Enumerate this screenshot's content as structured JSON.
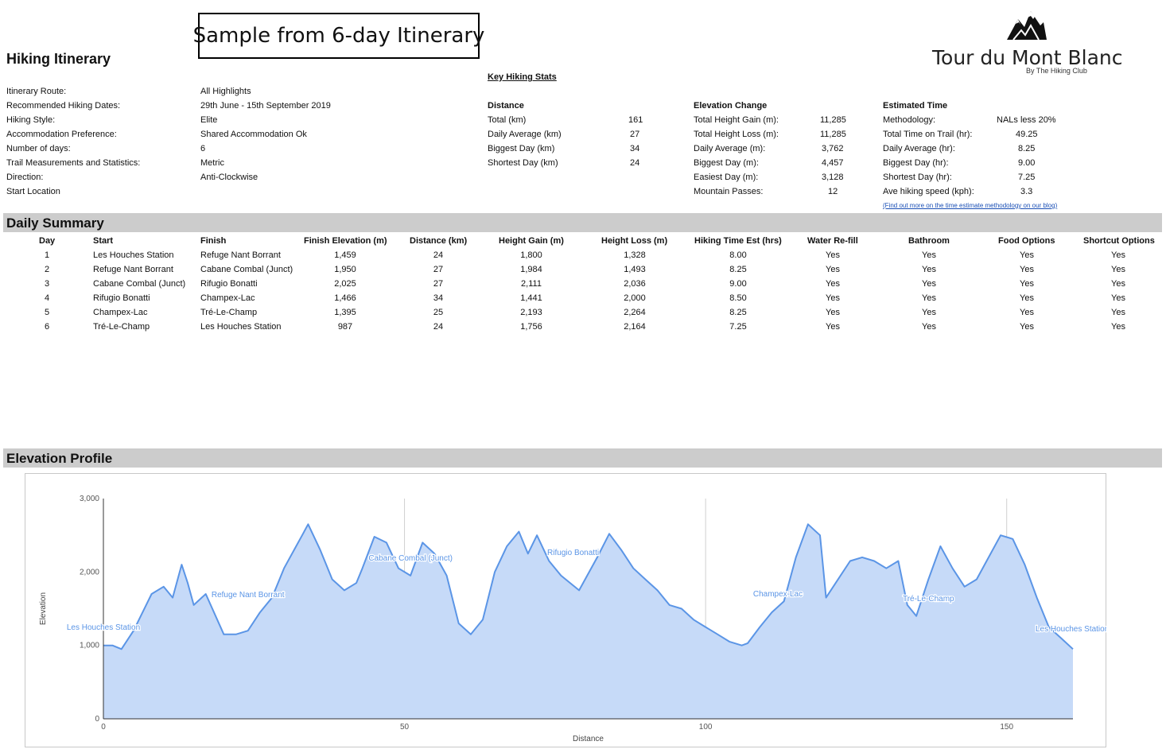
{
  "header": {
    "title": "Hiking Itinerary",
    "sample_label": "Sample from 6-day Itinerary",
    "logo_name": "Tour du Mont Blanc",
    "logo_sub": "By The Hiking Club"
  },
  "itinerary": [
    {
      "label": "Itinerary Route:",
      "value": "All Highlights"
    },
    {
      "label": "Recommended Hiking Dates:",
      "value": "29th June - 15th September 2019"
    },
    {
      "label": "Hiking Style:",
      "value": "Elite"
    },
    {
      "label": "Accommodation Preference:",
      "value": "Shared Accommodation Ok"
    },
    {
      "label": "Number of days:",
      "value": "6"
    },
    {
      "label": "Trail Measurements and Statistics:",
      "value": "Metric"
    },
    {
      "label": "Direction:",
      "value": "Anti-Clockwise"
    },
    {
      "label": "Start Location",
      "value": ""
    }
  ],
  "key_stats": {
    "heading": "Key Hiking Stats",
    "distance": {
      "heading": "Distance",
      "rows": [
        {
          "label": "Total (km)",
          "value": "161"
        },
        {
          "label": "Daily Average (km)",
          "value": "27"
        },
        {
          "label": "Biggest Day (km)",
          "value": "34"
        },
        {
          "label": "Shortest Day (km)",
          "value": "24"
        }
      ]
    },
    "elevation": {
      "heading": "Elevation Change",
      "rows": [
        {
          "label": "Total Height Gain (m):",
          "value": "11,285"
        },
        {
          "label": "Total Height Loss (m):",
          "value": "11,285"
        },
        {
          "label": "Daily Average (m):",
          "value": "3,762"
        },
        {
          "label": "Biggest Day (m):",
          "value": "4,457"
        },
        {
          "label": "Easiest Day (m):",
          "value": "3,128"
        },
        {
          "label": "Mountain Passes:",
          "value": "12"
        }
      ]
    },
    "time": {
      "heading": "Estimated Time",
      "rows": [
        {
          "label": "Methodology:",
          "value": "NALs less 20%"
        },
        {
          "label": "Total Time on Trail (hr):",
          "value": "49.25"
        },
        {
          "label": "Daily Average (hr):",
          "value": "8.25"
        },
        {
          "label": "Biggest Day (hr):",
          "value": "9.00"
        },
        {
          "label": "Shortest Day (hr):",
          "value": "7.25"
        },
        {
          "label": "Ave hiking speed (kph):",
          "value": "3.3"
        }
      ],
      "link": "(Find out more on the time estimate methodology on our blog)"
    }
  },
  "daily_summary": {
    "heading": "Daily Summary",
    "columns": [
      "Day",
      "Start",
      "Finish",
      "Finish Elevation (m)",
      "Distance (km)",
      "Height Gain (m)",
      "Height Loss (m)",
      "Hiking Time Est (hrs)",
      "Water Re-fill",
      "Bathroom",
      "Food Options",
      "Shortcut Options"
    ],
    "rows": [
      [
        "1",
        "Les Houches Station",
        "Refuge Nant Borrant",
        "1,459",
        "24",
        "1,800",
        "1,328",
        "8.00",
        "Yes",
        "Yes",
        "Yes",
        "Yes"
      ],
      [
        "2",
        "Refuge Nant Borrant",
        "Cabane Combal (Junct)",
        "1,950",
        "27",
        "1,984",
        "1,493",
        "8.25",
        "Yes",
        "Yes",
        "Yes",
        "Yes"
      ],
      [
        "3",
        "Cabane Combal (Junct)",
        "Rifugio Bonatti",
        "2,025",
        "27",
        "2,111",
        "2,036",
        "9.00",
        "Yes",
        "Yes",
        "Yes",
        "Yes"
      ],
      [
        "4",
        "Rifugio Bonatti",
        "Champex-Lac",
        "1,466",
        "34",
        "1,441",
        "2,000",
        "8.50",
        "Yes",
        "Yes",
        "Yes",
        "Yes"
      ],
      [
        "5",
        "Champex-Lac",
        "Tré-Le-Champ",
        "1,395",
        "25",
        "2,193",
        "2,264",
        "8.25",
        "Yes",
        "Yes",
        "Yes",
        "Yes"
      ],
      [
        "6",
        "Tré-Le-Champ",
        "Les Houches Station",
        "987",
        "24",
        "1,756",
        "2,164",
        "7.25",
        "Yes",
        "Yes",
        "Yes",
        "Yes"
      ]
    ]
  },
  "elevation_profile": {
    "heading": "Elevation Profile"
  },
  "colors": {
    "section_bar": "#cccccc",
    "area_fill": "#c6daf8",
    "line": "#5b95e6",
    "label": "#5b95e6",
    "link": "#1a4fb5"
  },
  "chart_data": {
    "type": "area",
    "title": "",
    "xlabel": "Distance",
    "ylabel": "Elevation",
    "xlim": [
      0,
      161
    ],
    "ylim": [
      0,
      3000
    ],
    "x_ticks": [
      "0",
      "50",
      "100",
      "150"
    ],
    "y_ticks": [
      "0",
      "1,000",
      "2,000",
      "3,000"
    ],
    "grid": "vertical",
    "series": [
      {
        "x": [
          0,
          1.5,
          3,
          5,
          8,
          10,
          11.5,
          13,
          14,
          15,
          17,
          20,
          22,
          24,
          26,
          28,
          30,
          32,
          33,
          34,
          36,
          38,
          40,
          42,
          43,
          45,
          47,
          49,
          51,
          53,
          55,
          57,
          59,
          61,
          63,
          65,
          67,
          69,
          70.5,
          72,
          74,
          76,
          79,
          82,
          84,
          86,
          88,
          90,
          92,
          94,
          96,
          98,
          100,
          102,
          104,
          106,
          107,
          109,
          111,
          113,
          115,
          117,
          119,
          120,
          122,
          124,
          126,
          128,
          130,
          132,
          133.5,
          135,
          137,
          139,
          141,
          143,
          145,
          147,
          149,
          151,
          153,
          155,
          157,
          159,
          161
        ],
        "y": [
          1000,
          1000,
          950,
          1200,
          1700,
          1800,
          1650,
          2100,
          1850,
          1550,
          1700,
          1150,
          1150,
          1200,
          1450,
          1650,
          2050,
          2350,
          2500,
          2650,
          2300,
          1900,
          1750,
          1850,
          2050,
          2480,
          2400,
          2050,
          1950,
          2400,
          2250,
          1950,
          1300,
          1150,
          1350,
          2000,
          2350,
          2550,
          2250,
          2500,
          2150,
          1950,
          1750,
          2200,
          2520,
          2300,
          2050,
          1900,
          1750,
          1550,
          1500,
          1350,
          1250,
          1150,
          1050,
          1000,
          1030,
          1250,
          1450,
          1600,
          2200,
          2650,
          2500,
          1650,
          1900,
          2150,
          2200,
          2150,
          2050,
          2150,
          1550,
          1400,
          1900,
          2350,
          2050,
          1800,
          1900,
          2200,
          2500,
          2450,
          2100,
          1650,
          1250,
          1100,
          950
        ]
      }
    ],
    "annotations": [
      {
        "x": 0,
        "label": "Les Houches Station"
      },
      {
        "x": 24,
        "label": "Refuge Nant Borrant"
      },
      {
        "x": 51,
        "label": "Cabane Combal (Junct)"
      },
      {
        "x": 78,
        "label": "Rifugio Bonatti"
      },
      {
        "x": 112,
        "label": "Champex-Lac"
      },
      {
        "x": 137,
        "label": "Tré-Le-Champ"
      },
      {
        "x": 161,
        "label": "Les Houches Station"
      }
    ]
  }
}
